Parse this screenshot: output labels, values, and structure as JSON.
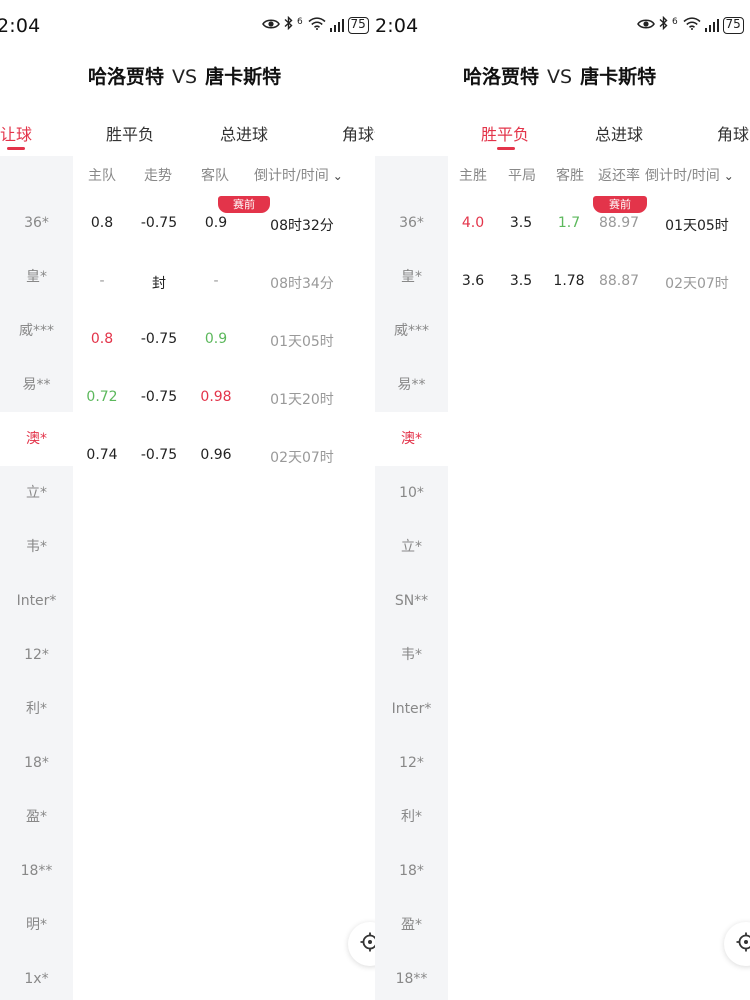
{
  "status_bar": {
    "left_time": "2:04",
    "right_time": "2:04",
    "network_label": "6",
    "battery": "75"
  },
  "match": {
    "home": "哈洛贾特",
    "vs": "VS",
    "away": "唐卡斯特"
  },
  "left_panel": {
    "tabs": [
      "让球",
      "胜平负",
      "总进球",
      "角球让球"
    ],
    "active_tab": "让球",
    "columns": [
      "主队",
      "走势",
      "客队",
      "倒计时/时间"
    ],
    "chip": "赛前",
    "sidebar": [
      "36*",
      "皇*",
      "威***",
      "易**",
      "澳*",
      "立*",
      "韦*",
      "Inter*",
      "12*",
      "利*",
      "18*",
      "盈*",
      "18**",
      "明*",
      "1x*"
    ],
    "active_sidebar": "澳*",
    "rows": [
      {
        "home": "0.8",
        "trend": "-0.75",
        "away": "0.9",
        "time": "08时32分"
      },
      {
        "home": "-",
        "trend": "封",
        "away": "-",
        "time": "08时34分"
      },
      {
        "home": "0.8",
        "trend": "-0.75",
        "away": "0.9",
        "time": "01天05时"
      },
      {
        "home": "0.72",
        "trend": "-0.75",
        "away": "0.98",
        "time": "01天20时"
      },
      {
        "home": "0.74",
        "trend": "-0.75",
        "away": "0.96",
        "time": "02天07时"
      }
    ]
  },
  "right_panel": {
    "tabs": [
      "胜平负",
      "总进球",
      "角球"
    ],
    "active_tab": "胜平负",
    "columns": [
      "主胜",
      "平局",
      "客胜",
      "返还率",
      "倒计时/时间"
    ],
    "chip": "赛前",
    "sidebar": [
      "36*",
      "皇*",
      "威***",
      "易**",
      "澳*",
      "10*",
      "立*",
      "SN**",
      "韦*",
      "Inter*",
      "12*",
      "利*",
      "18*",
      "盈*",
      "18**"
    ],
    "active_sidebar": "澳*",
    "rows": [
      {
        "home": "4.0",
        "draw": "3.5",
        "away": "1.7",
        "return": "88.97",
        "time": "01天05时"
      },
      {
        "home": "3.6",
        "draw": "3.5",
        "away": "1.78",
        "return": "88.87",
        "time": "02天07时"
      }
    ]
  },
  "colors": {
    "accent": "#e3344a",
    "up": "#5cb85c",
    "muted": "#999999",
    "sidebar_bg": "#f4f5f7"
  },
  "icons": [
    "eye-icon",
    "bluetooth-icon",
    "wifi-icon",
    "signal-icon",
    "battery-icon",
    "sort-chevron-icon",
    "locate-icon"
  ]
}
